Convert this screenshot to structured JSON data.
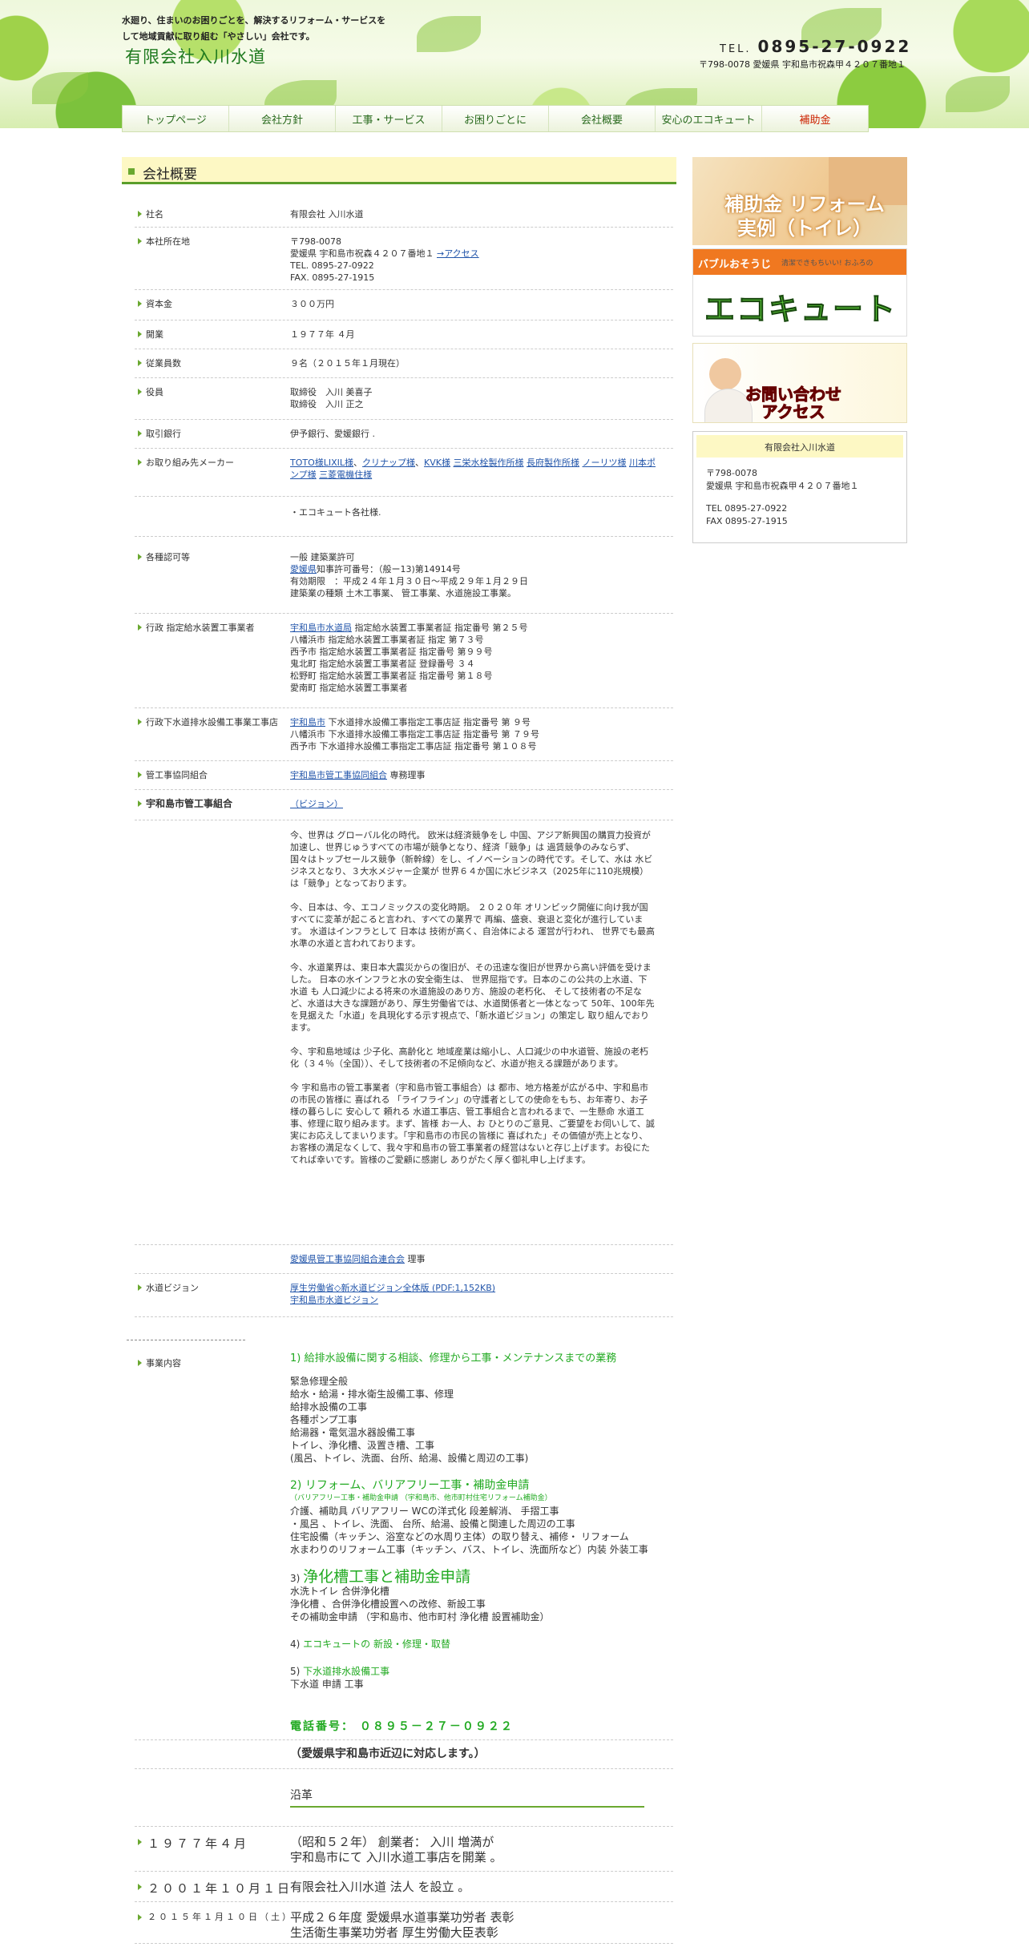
{
  "header": {
    "tagline": "水廻り、住まいのお困りごとを、解決するリフォーム・サービスをして地域貢献に取り組む「やさしい」会社です。",
    "logo": "有限会社入川水道",
    "tel_prefix": "TEL.",
    "tel": "0895-27-0922",
    "address": "〒798-0078 愛媛県 宇和島市祝森甲４２０７番地１"
  },
  "nav": [
    "トップページ",
    "会社方針",
    "工事・サービス",
    "お困りごとに",
    "会社概要",
    "安心のエコキュート",
    "補助金"
  ],
  "page_title": "会社概要",
  "rows": {
    "r1": {
      "label": "社名",
      "value": "有限会社 入川水道"
    },
    "r2": {
      "label": "本社所在地",
      "zip": "〒798-0078",
      "addr": "愛媛県 宇和島市祝森４２０７番地１",
      "link": "→アクセス",
      "tel": "TEL. 0895-27-0922",
      "fax": "FAX. 0895-27-1915"
    },
    "r3": {
      "label": "資本金",
      "value": "３００万円"
    },
    "r4": {
      "label": "開業",
      "value": "１９７７年 ４月"
    },
    "r5": {
      "label": "従業員数",
      "value": "９名（２０１５年１月現在）"
    },
    "r6": {
      "label": "役員",
      "v1": "取締役　入川 美喜子",
      "v2": "取締役　入川 正之"
    },
    "r7": {
      "label": "取引銀行",
      "value": "伊予銀行、愛媛銀行 ."
    },
    "r8": {
      "label": "お取り組み先メーカー",
      "links": [
        "TOTO様",
        "LIXIL様",
        "クリナップ様",
        "KVK様",
        "三栄水栓製作所様",
        "長府製作所様",
        "ノーリツ様",
        "川本ポンプ様",
        "三菱電機住様"
      ]
    },
    "r9": {
      "value": "・エコキュート各社様."
    },
    "r10": {
      "label": "各種認可等",
      "v1": "一般 建築業許可",
      "link": "愛媛県",
      "v2": "知事許可番号：（般ー13)第14914号",
      "v3": "有効期限　：平成２４年１月３０日〜平成２９年１月２９日",
      "v4": "建築業の種類 土木工事業、 管工事業、水道施設工事業。"
    },
    "r11": {
      "label": "行政 指定給水装置工事業者",
      "link": "宇和島市水道局",
      "v1": " 指定給水装置工事業者証 指定番号 第２５号",
      "v2": "八幡浜市 指定給水装置工事業者証 指定 第７３号",
      "v3": "西予市 指定給水装置工事業者証 指定番号 第９９号",
      "v4": "鬼北町 指定給水装置工事業者証 登録番号 ３４",
      "v5": "松野町 指定給水装置工事業者証 指定番号 第１８号",
      "v6": "愛南町 指定給水装置工事業者"
    },
    "r12": {
      "label": "行政下水道排水設備工事業工事店",
      "link": "宇和島市",
      "v1": " 下水道排水設備工事指定工事店証 指定番号 第 ９号",
      "v2": "八幡浜市 下水道排水設備工事指定工事店証 指定番号 第 ７９号",
      "v3": "西予市 下水道排水設備工事指定工事店証 指定番号 第１０８号"
    },
    "r13": {
      "label": "管工事協同組合",
      "link": "宇和島市管工事協同組合",
      "value": " 専務理事"
    },
    "r14": {
      "label": "宇和島市管工事組合",
      "link": "（ビジョン）"
    },
    "r15": {
      "link": "愛媛県管工事協同組合連合会",
      "value": " 理事"
    },
    "r16": {
      "label": "水道ビジョン",
      "link1": "厚生労働省◇新水道ビジョン全体版 (PDF:1,152KB)",
      "link2": "宇和島市水道ビジョン"
    }
  },
  "vision": [
    "今、世界は グローバル化の時代。 欧米は経済競争をし 中国、アジア新興国の購買力投資が加速し、世界じゅうすべての市場が競争となり、経済「競争」は 過賃競争のみならず、 国々はトップセールス競争（新幹線）をし、イノベーションの時代です。そして、水は 水ビジネスとなり、３大水メジャー企業が 世界６４か国に水ビジネス（2025年に110兆規模）は「競争」となっております。",
    "今、日本は、今、エコノミックスの変化時期。 ２０２０年 オリンピック開催に向け我が国 すべてに変革が起こると言われ、すべての業界で 再編、盛衰、衰退と変化が進行しています。 水道はインフラとして 日本は 技術が高く、自治体による 運営が行われ、 世界でも最高水準の水道と言われております。",
    "今、水道業界は、東日本大震災からの復旧が、その迅速な復旧が世界から高い評価を受けました。 日本の水インフラと水の安全衛生は、 世界屈指です。日本のこの公共の上水道、下水道 も 人口減少による将来の水道施設のあり方、施設の老朽化、 そして技術者の不足など、水道は大きな課題があり、厚生労働省では、水道関係者と一体となって 50年、100年先を見据えた「水道」を具現化する示す視点で、「新水道ビジョン」の策定し 取り組んでおります。",
    "今、宇和島地域は 少子化、高齢化と 地域産業は縮小し、人口減少の中水道管、施設の老朽化（３４％（全国））、そして技術者の不足傾向など、水道が抱える課題があります。",
    "今 宇和島市の管工事業者（宇和島市管工事組合）は 都市、地方格差が広がる中、宇和島市の市民の皆様に 喜ばれる 「ライフライン」の守護者としての使命をもち、お年寄り、お子様の暮らしに 安心して 頼れる 水道工事店、管工事組合と言われるまで、一生懸命 水道工事、修理に取り組みます。まず、皆様 お一人、お ひとりのご意見、ご要望をお伺いして、誠実にお応えしてまいります。「宇和島市の市民の皆様に 喜ばれた」その価値が売上となり、お客様の満足なくして、我々宇和島市の管工事業者の経営はないと存じ上げます。お役にたてれば幸いです。皆様のご愛顧に感謝し ありがたく厚く御礼申し上げます。"
  ],
  "business": {
    "label": "事業内容",
    "h1": "1) 給排水設備に関する相談、修理から工事・メンテナンスまでの業務",
    "l1": [
      "緊急修理全般",
      "給水・給湯・排水衛生設備工事、修理",
      "給排水設備の工事",
      "各種ポンプ工事",
      "給湯器・電気温水器設備工事",
      "トイレ、浄化槽、汲置き槽、工事",
      "(風呂、トイレ、洗面、台所、給湯、設備と周辺の工事)"
    ],
    "h2": "2) リフォーム、バリアフリー工事・補助金申請",
    "h2s": "（バリアフリー工事・補助金申請 （宇和島市、他市町村住宅リフォーム補助金）",
    "l2": [
      "介護、補助具 バリアフリー WCの洋式化 段差解消、 手摺工事",
      "・風呂 、トイレ、洗面、 台所、給湯、設備と関連した周辺の工事",
      "住宅設備（キッチン、浴室などの水周り主体）の取り替え、補修・ リフォーム",
      "水まわりのリフォーム工事（キッチン、バス、トイレ、洗面所など）内装 外装工事"
    ],
    "h3n": "3) ",
    "h3": "浄化槽工事と補助金申請",
    "l3": [
      "水洗トイレ 合併浄化槽",
      "浄化槽 、合併浄化槽設置への改修、新設工事",
      "その補助金申請 （宇和島市、他市町村 浄化槽 設置補助金）"
    ],
    "h4n": "4) ",
    "h4": "エコキュートの 新設・修理・取替",
    "h5n": "5) ",
    "h5": "下水道排水設備工事",
    "l5": "下水道 申請 工事",
    "phone": "電話番号： ０８９５－２７－０９２２",
    "area": "（愛媛県宇和島市近辺に対応します。）",
    "history_title": "沿革"
  },
  "history": [
    {
      "date": "１９７７年４月",
      "text1": "（昭和５２年） 創業者： 入川 増満が",
      "text2": "宇和島市にて 入川水道工事店を開業 。"
    },
    {
      "date": "２００１年１０月１日",
      "text1": "有限会社入川水道 法人 を設立 。",
      "text2": ""
    },
    {
      "date": "２０１５年１月１０日（土）",
      "text1": "平成２６年度 愛媛県水道事業功労者 表彰",
      "text2": "生活衛生事業功労者 厚生労働大臣表彰"
    }
  ],
  "sidebar": {
    "banner1": "補助金 リフォーム実例（トイレ）",
    "banner2_bar": "バブルおそうじ",
    "banner2_sub": "清潔できもちいい! おふろの",
    "banner2_main": "エコキュート",
    "banner3": "お問い合わせアクセス",
    "info_title": "有限会社入川水道",
    "info_zip": "〒798-0078",
    "info_addr": "愛媛県 宇和島市祝森甲４２０７番地１",
    "info_tel": "TEL 0895-27-0922",
    "info_fax": "FAX 0895-27-1915"
  },
  "colors": {
    "accent": "#6aa830",
    "title_bg": "#fdf8c4",
    "green_text": "#22aa22"
  }
}
